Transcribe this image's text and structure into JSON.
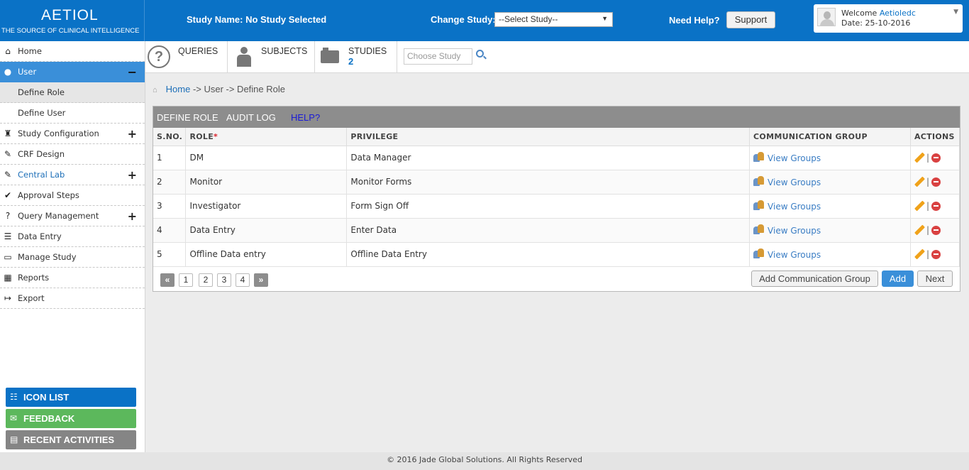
{
  "header": {
    "brand": "AETIOL",
    "tagline": "THE SOURCE OF CLINICAL INTELLIGENCE",
    "study_name": "Study Name: No Study Selected",
    "change_study_label": "Change Study:",
    "study_select_value": "--Select Study--",
    "need_help": "Need Help?",
    "support_label": "Support",
    "welcome_label": "Welcome",
    "username": "Aetioledc",
    "date_label": "Date: 25-10-2016"
  },
  "sidebar": {
    "items": [
      {
        "label": "Home",
        "icon": "home-icon"
      },
      {
        "label": "User",
        "icon": "user-icon",
        "toggle": "−"
      },
      {
        "label": "Define Role"
      },
      {
        "label": "Define User"
      },
      {
        "label": "Study Configuration",
        "icon": "study-config-icon",
        "toggle": "+"
      },
      {
        "label": "CRF Design",
        "icon": "crf-design-icon"
      },
      {
        "label": "Central Lab",
        "icon": "central-lab-icon",
        "toggle": "+"
      },
      {
        "label": "Approval Steps",
        "icon": "approval-icon"
      },
      {
        "label": "Query Management",
        "icon": "query-icon",
        "toggle": "+"
      },
      {
        "label": "Data Entry",
        "icon": "data-entry-icon"
      },
      {
        "label": "Manage Study",
        "icon": "manage-study-icon"
      },
      {
        "label": "Reports",
        "icon": "reports-icon"
      },
      {
        "label": "Export",
        "icon": "export-icon"
      }
    ],
    "buttons": {
      "icon_list": "ICON LIST",
      "feedback": "FEEDBACK",
      "recent_activities": "RECENT ACTIVITIES"
    }
  },
  "toolbar": {
    "queries": "QUERIES",
    "subjects": "SUBJECTS",
    "studies": "STUDIES",
    "studies_count": "2",
    "choose_study_placeholder": "Choose Study"
  },
  "breadcrumb": {
    "home": "Home",
    "rest": "-> User -> Define Role"
  },
  "panel": {
    "tabs": {
      "define_role": "DEFINE ROLE",
      "audit_log": "AUDIT LOG",
      "help": "HELP?"
    },
    "columns": {
      "sno": "S.NO.",
      "role": "ROLE",
      "role_required": "*",
      "privilege": "PRIVILEGE",
      "communication_group": "COMMUNICATION GROUP",
      "actions": "ACTIONS"
    },
    "rows": [
      {
        "sno": "1",
        "role": "DM",
        "privilege": "Data Manager",
        "group_link": "View Groups"
      },
      {
        "sno": "2",
        "role": "Monitor",
        "privilege": "Monitor Forms",
        "group_link": "View Groups"
      },
      {
        "sno": "3",
        "role": "Investigator",
        "privilege": "Form Sign Off",
        "group_link": "View Groups"
      },
      {
        "sno": "4",
        "role": "Data Entry",
        "privilege": "Enter Data",
        "group_link": "View Groups"
      },
      {
        "sno": "5",
        "role": "Offline Data entry",
        "privilege": "Offline Data Entry",
        "group_link": "View Groups"
      }
    ],
    "action_separator": "|",
    "pagination": {
      "prev": "«",
      "pages": [
        "1",
        "2",
        "3",
        "4"
      ],
      "next": "»"
    },
    "buttons": {
      "add_group": "Add Communication Group",
      "add": "Add",
      "next": "Next"
    }
  },
  "footer": {
    "text": "© 2016 Jade Global Solutions. All Rights Reserved"
  },
  "colors": {
    "primary": "#0a72c6",
    "active_nav": "#3a8fd9",
    "feedback": "#5cb85c",
    "recent": "#858585",
    "panel_header": "#8d8d8d"
  }
}
